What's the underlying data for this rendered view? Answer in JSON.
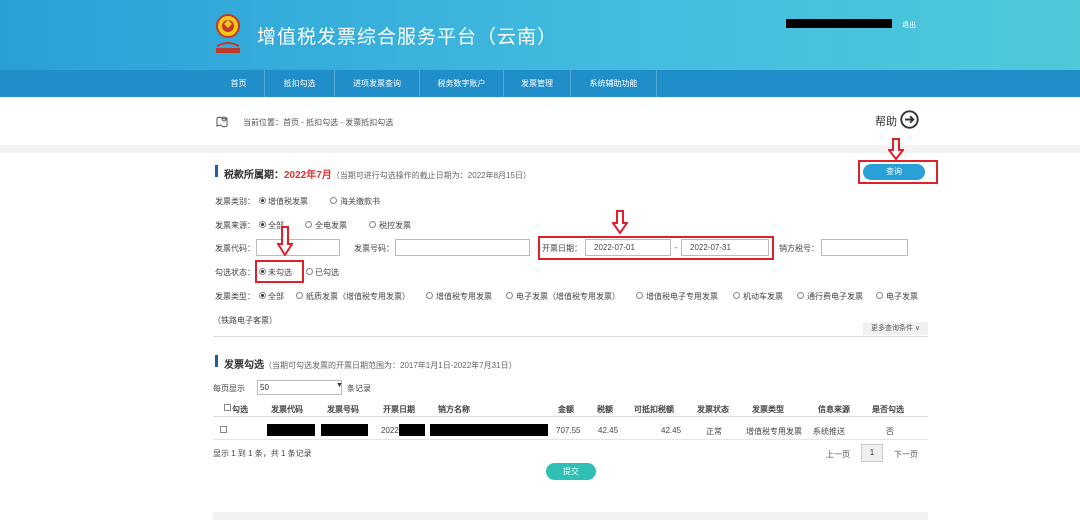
{
  "app": {
    "title": "增值税发票综合服务平台（云南）",
    "logout": "退出"
  },
  "nav": {
    "items": [
      "首页",
      "抵扣勾选",
      "进项发票查询",
      "税务数字账户",
      "发票管理",
      "系统辅助功能"
    ]
  },
  "breadcrumb": {
    "text": "当前位置：首页 - 抵扣勾选 - 发票抵扣勾选",
    "help": "帮助"
  },
  "period_section": {
    "label": "税款所属期：",
    "period": "2022年7月",
    "note": "（当期可进行勾选操作的截止日期为：2022年8月15日）",
    "query_button": "查询"
  },
  "filters": {
    "invoice_category_label": "发票类别：",
    "invoice_category_options": [
      "增值税发票",
      "海关缴款书"
    ],
    "invoice_source_label": "发票来源：",
    "invoice_source_options": [
      "全部",
      "全电发票",
      "税控发票"
    ],
    "invoice_code_label": "发票代码：",
    "invoice_number_label": "发票号码：",
    "issue_date_label": "开票日期：",
    "issue_date_from": "2022-07-01",
    "issue_date_sep": "-",
    "issue_date_to": "2022-07-31",
    "seller_tax_label": "销方税号：",
    "check_status_label": "勾选状态：",
    "check_status_options": [
      "未勾选",
      "已勾选"
    ],
    "invoice_type_label": "发票类型：",
    "invoice_type_options": [
      "全部",
      "纸质发票（增值税专用发票）",
      "增值税专用发票",
      "电子发票（增值税专用发票）",
      "增值税电子专用发票",
      "机动车发票",
      "通行费电子发票",
      "电子发票"
    ],
    "invoice_type_wrap": "（铁路电子客票）",
    "more_conditions": "更多查询条件 ∨"
  },
  "list_section": {
    "title": "发票勾选",
    "note": "（当期可勾选发票的开票日期范围为：2017年1月1日-2022年7月31日）",
    "per_page_label": "每页显示",
    "per_page_value": "50",
    "per_page_suffix": "条记录",
    "columns": [
      "勾选",
      "发票代码",
      "发票号码",
      "开票日期",
      "销方名称",
      "金额",
      "税额",
      "可抵扣税额",
      "发票状态",
      "发票类型",
      "信息来源",
      "是否勾选"
    ],
    "rows": [
      {
        "issue_date": "2022-",
        "amount": "707.55",
        "tax": "42.45",
        "deductible_tax": "42.45",
        "status": "正常",
        "type": "增值税专用发票",
        "source": "系统推送",
        "checked": "否"
      }
    ],
    "summary": "显示 1 到 1 条，共 1 条记录",
    "prev": "上一页",
    "page": "1",
    "next": "下一页",
    "submit": "提交"
  },
  "colors": {
    "header": "#2a9fd6",
    "nav": "#1f8ec9",
    "accent_red": "#e0212b",
    "button_blue": "#2aa0d8",
    "button_teal": "#2fbfb5"
  }
}
